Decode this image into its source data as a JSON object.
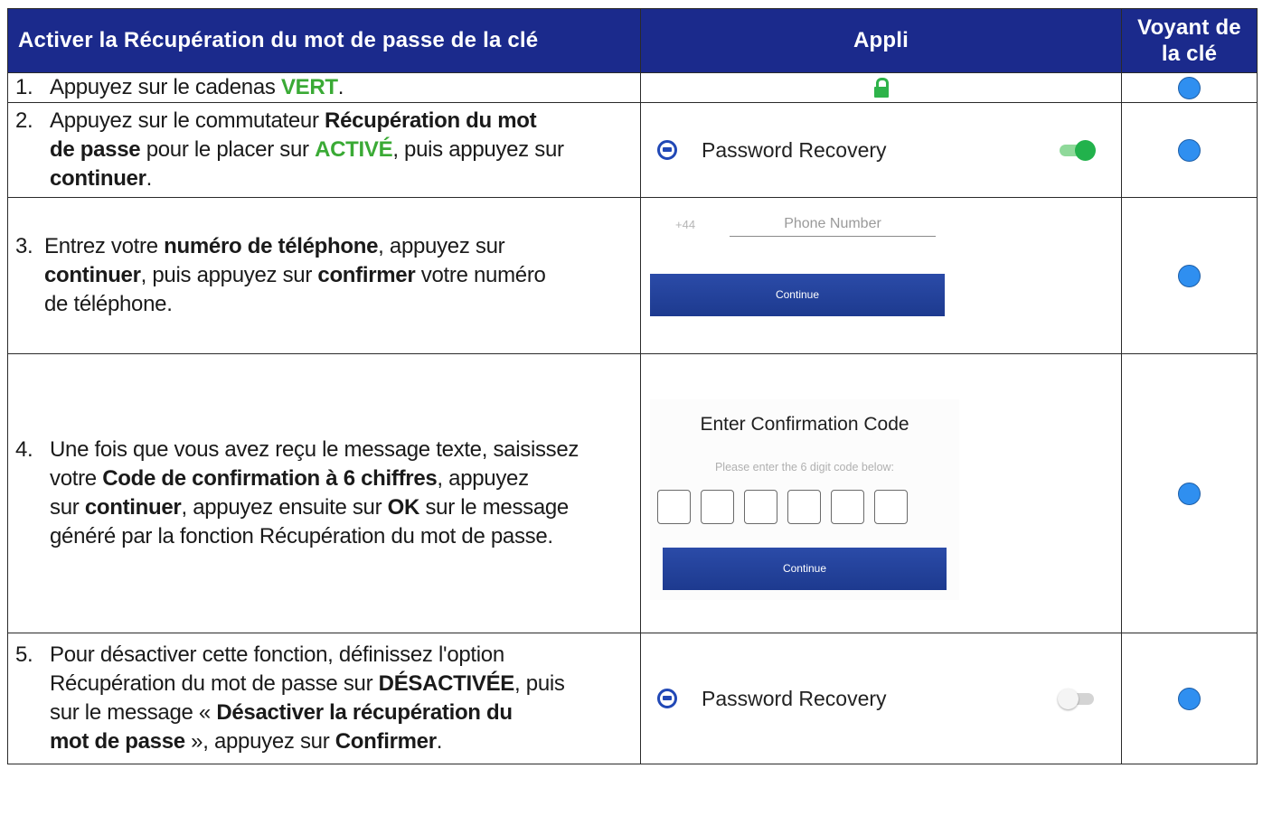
{
  "header": {
    "col1": "Activer la Récupération du mot de passe de la clé",
    "col2": "Appli",
    "col3_line1": "Voyant de",
    "col3_line2": "la clé"
  },
  "colors": {
    "header_bg": "#1b2a8c",
    "green": "#3aaa35",
    "led_blue": "#2f8ff0",
    "button_blue": "#2148b6"
  },
  "steps": [
    {
      "num": "1.",
      "t1": "Appuyez sur le cadenas ",
      "t2": "VERT",
      "t3": "."
    },
    {
      "num": "2.",
      "l1a": "Appuyez sur le commutateur ",
      "l1b": "Récupération du mot",
      "l2a": "de passe",
      "l2b": " pour le placer sur ",
      "l2c": "ACTIVÉ",
      "l2d": ", puis appuyez sur",
      "l3a": "continuer",
      "l3b": "."
    },
    {
      "num": "3.",
      "l1a": "Entrez votre ",
      "l1b": "numéro de téléphone",
      "l1c": ", appuyez sur",
      "l2a": "continuer",
      "l2b": ", puis appuyez sur ",
      "l2c": "confirmer",
      "l2d": " votre numéro",
      "l3a": "de téléphone."
    },
    {
      "num": "4.",
      "l1a": "Une fois que vous avez reçu le message texte, saisissez",
      "l2a": "votre ",
      "l2b": "Code de confirmation à 6 chiffres",
      "l2c": ", appuyez",
      "l3a": "sur ",
      "l3b": "continuer",
      "l3c": ", appuyez ensuite sur ",
      "l3d": "OK",
      "l3e": "  sur le message",
      "l4a": "généré par la fonction Récupération du mot de passe."
    },
    {
      "num": "5.",
      "l1a": "Pour désactiver cette fonction, définissez l'option",
      "l2a": "Récupération du mot de passe sur ",
      "l2b": "DÉSACTIVÉE",
      "l2c": ", puis",
      "l3a": "sur le message « ",
      "l3b": "Désactiver la récupération du",
      "l4a": "mot de passe",
      "l4b": " », appuyez sur ",
      "l4c": "Confirmer",
      "l4d": "."
    }
  ],
  "app": {
    "lock_icon": "padlock-open-icon",
    "password_recovery_label": "Password Recovery",
    "toggle_on": true,
    "toggle_off": false,
    "country_code": "+44",
    "phone_placeholder": "Phone Number",
    "continue_label": "Continue",
    "confirm_title": "Enter Confirmation Code",
    "confirm_sub": "Please enter the 6 digit code below:"
  }
}
